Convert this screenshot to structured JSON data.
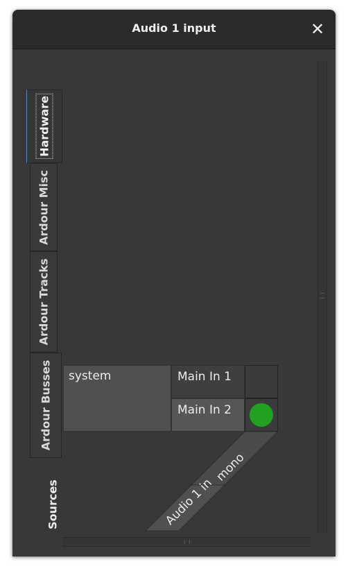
{
  "window": {
    "title": "Audio 1 input",
    "close_label": "✕"
  },
  "tabs": [
    {
      "label": "Hardware",
      "active": true
    },
    {
      "label": "Ardour Misc",
      "active": false
    },
    {
      "label": "Ardour Tracks",
      "active": false
    },
    {
      "label": "Ardour Busses",
      "active": false
    }
  ],
  "sources_label": "Sources",
  "matrix": {
    "group": "system",
    "ports": [
      "Main In 1",
      "Main In 2"
    ],
    "destination_group": "Audio 1 in",
    "destination_port": "mono",
    "connections": [
      false,
      true
    ]
  },
  "colors": {
    "connected": "#22a022",
    "accent": "#5a8bbd"
  }
}
